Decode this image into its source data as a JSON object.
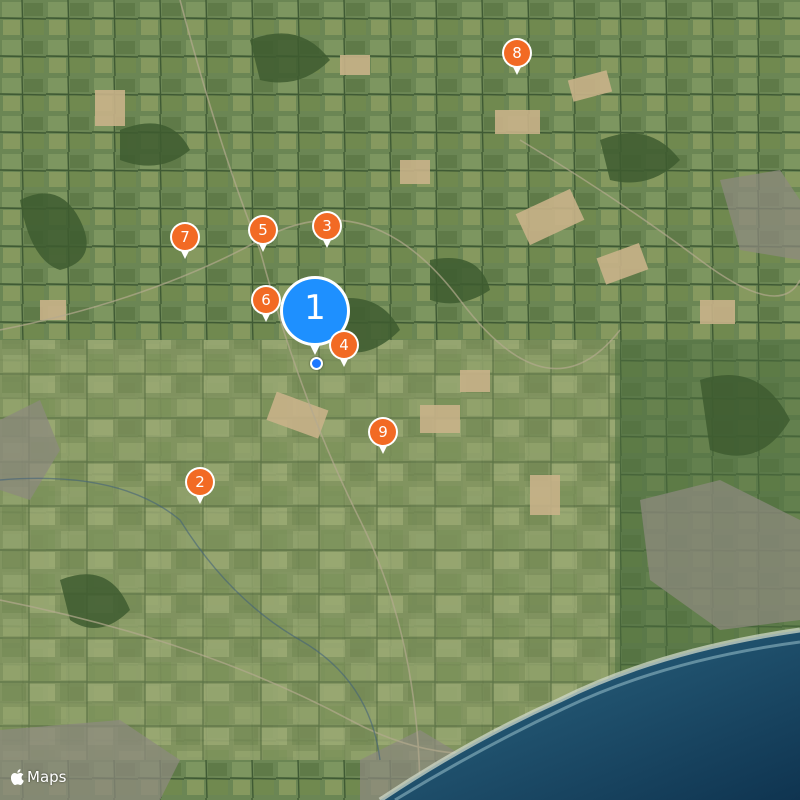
{
  "map": {
    "type": "satellite",
    "attribution": "Maps",
    "colors": {
      "pin_orange": "#f26a24",
      "pin_blue": "#1e90ff",
      "sea": "#1f4f70",
      "land": "#5d7a4a"
    }
  },
  "markers": [
    {
      "id": "1",
      "label": "1",
      "color": "#1e90ff",
      "selected": true
    },
    {
      "id": "2",
      "label": "2",
      "color": "#f26a24"
    },
    {
      "id": "3",
      "label": "3",
      "color": "#f26a24"
    },
    {
      "id": "4",
      "label": "4",
      "color": "#f26a24"
    },
    {
      "id": "5",
      "label": "5",
      "color": "#f26a24"
    },
    {
      "id": "6",
      "label": "6",
      "color": "#f26a24"
    },
    {
      "id": "7",
      "label": "7",
      "color": "#f26a24"
    },
    {
      "id": "8",
      "label": "8",
      "color": "#f26a24"
    },
    {
      "id": "9",
      "label": "9",
      "color": "#f26a24"
    }
  ]
}
